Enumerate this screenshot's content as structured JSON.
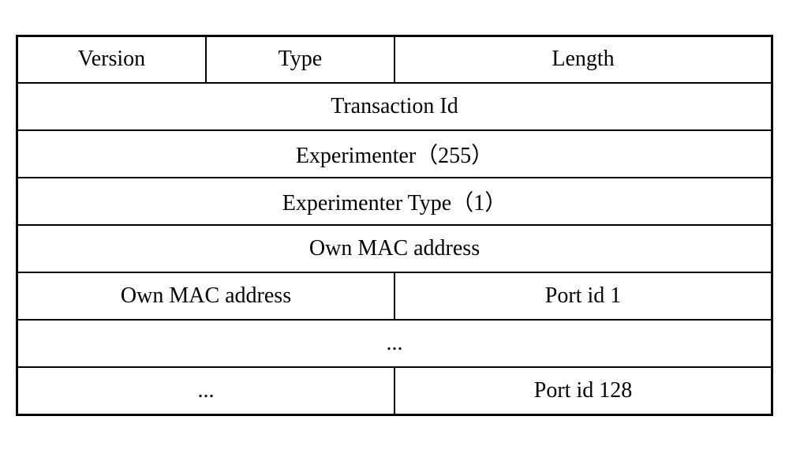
{
  "rows": {
    "header": {
      "version": "Version",
      "type": "Type",
      "length": "Length"
    },
    "transaction_id": "Transaction Id",
    "experimenter": "Experimenter（255）",
    "experimenter_type": "Experimenter Type（1）",
    "own_mac_full": "Own MAC address",
    "own_mac_half": "Own MAC address",
    "port_id_1": "Port id 1",
    "ellipsis_full": "...",
    "ellipsis_half": "...",
    "port_id_128": "Port id 128"
  }
}
